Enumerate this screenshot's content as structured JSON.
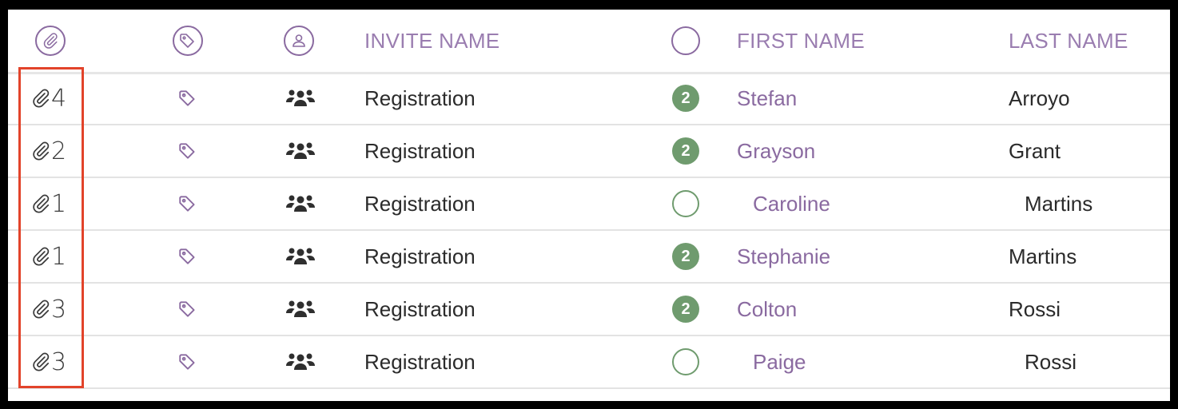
{
  "header": {
    "attachments_icon": "paperclip-icon",
    "tags_icon": "tag-icon",
    "contact_icon": "user-icon",
    "invite_name": "INVITE NAME",
    "status_icon": "circle-icon",
    "first_name": "FIRST NAME",
    "last_name": "LAST NAME"
  },
  "colors": {
    "accent": "#8a6aa0",
    "badge": "#6f9b6e",
    "highlight": "#e2432a"
  },
  "rows": [
    {
      "attachments": "4",
      "invite": "Registration",
      "badge": "2",
      "first": "Stefan",
      "last": "Arroyo"
    },
    {
      "attachments": "2",
      "invite": "Registration",
      "badge": "2",
      "first": "Grayson",
      "last": "Grant"
    },
    {
      "attachments": "1",
      "invite": "Registration",
      "badge": "",
      "first": "Caroline",
      "last": "Martins"
    },
    {
      "attachments": "1",
      "invite": "Registration",
      "badge": "2",
      "first": "Stephanie",
      "last": "Martins"
    },
    {
      "attachments": "3",
      "invite": "Registration",
      "badge": "2",
      "first": "Colton",
      "last": "Rossi"
    },
    {
      "attachments": "3",
      "invite": "Registration",
      "badge": "",
      "first": "Paige",
      "last": "Rossi"
    }
  ]
}
